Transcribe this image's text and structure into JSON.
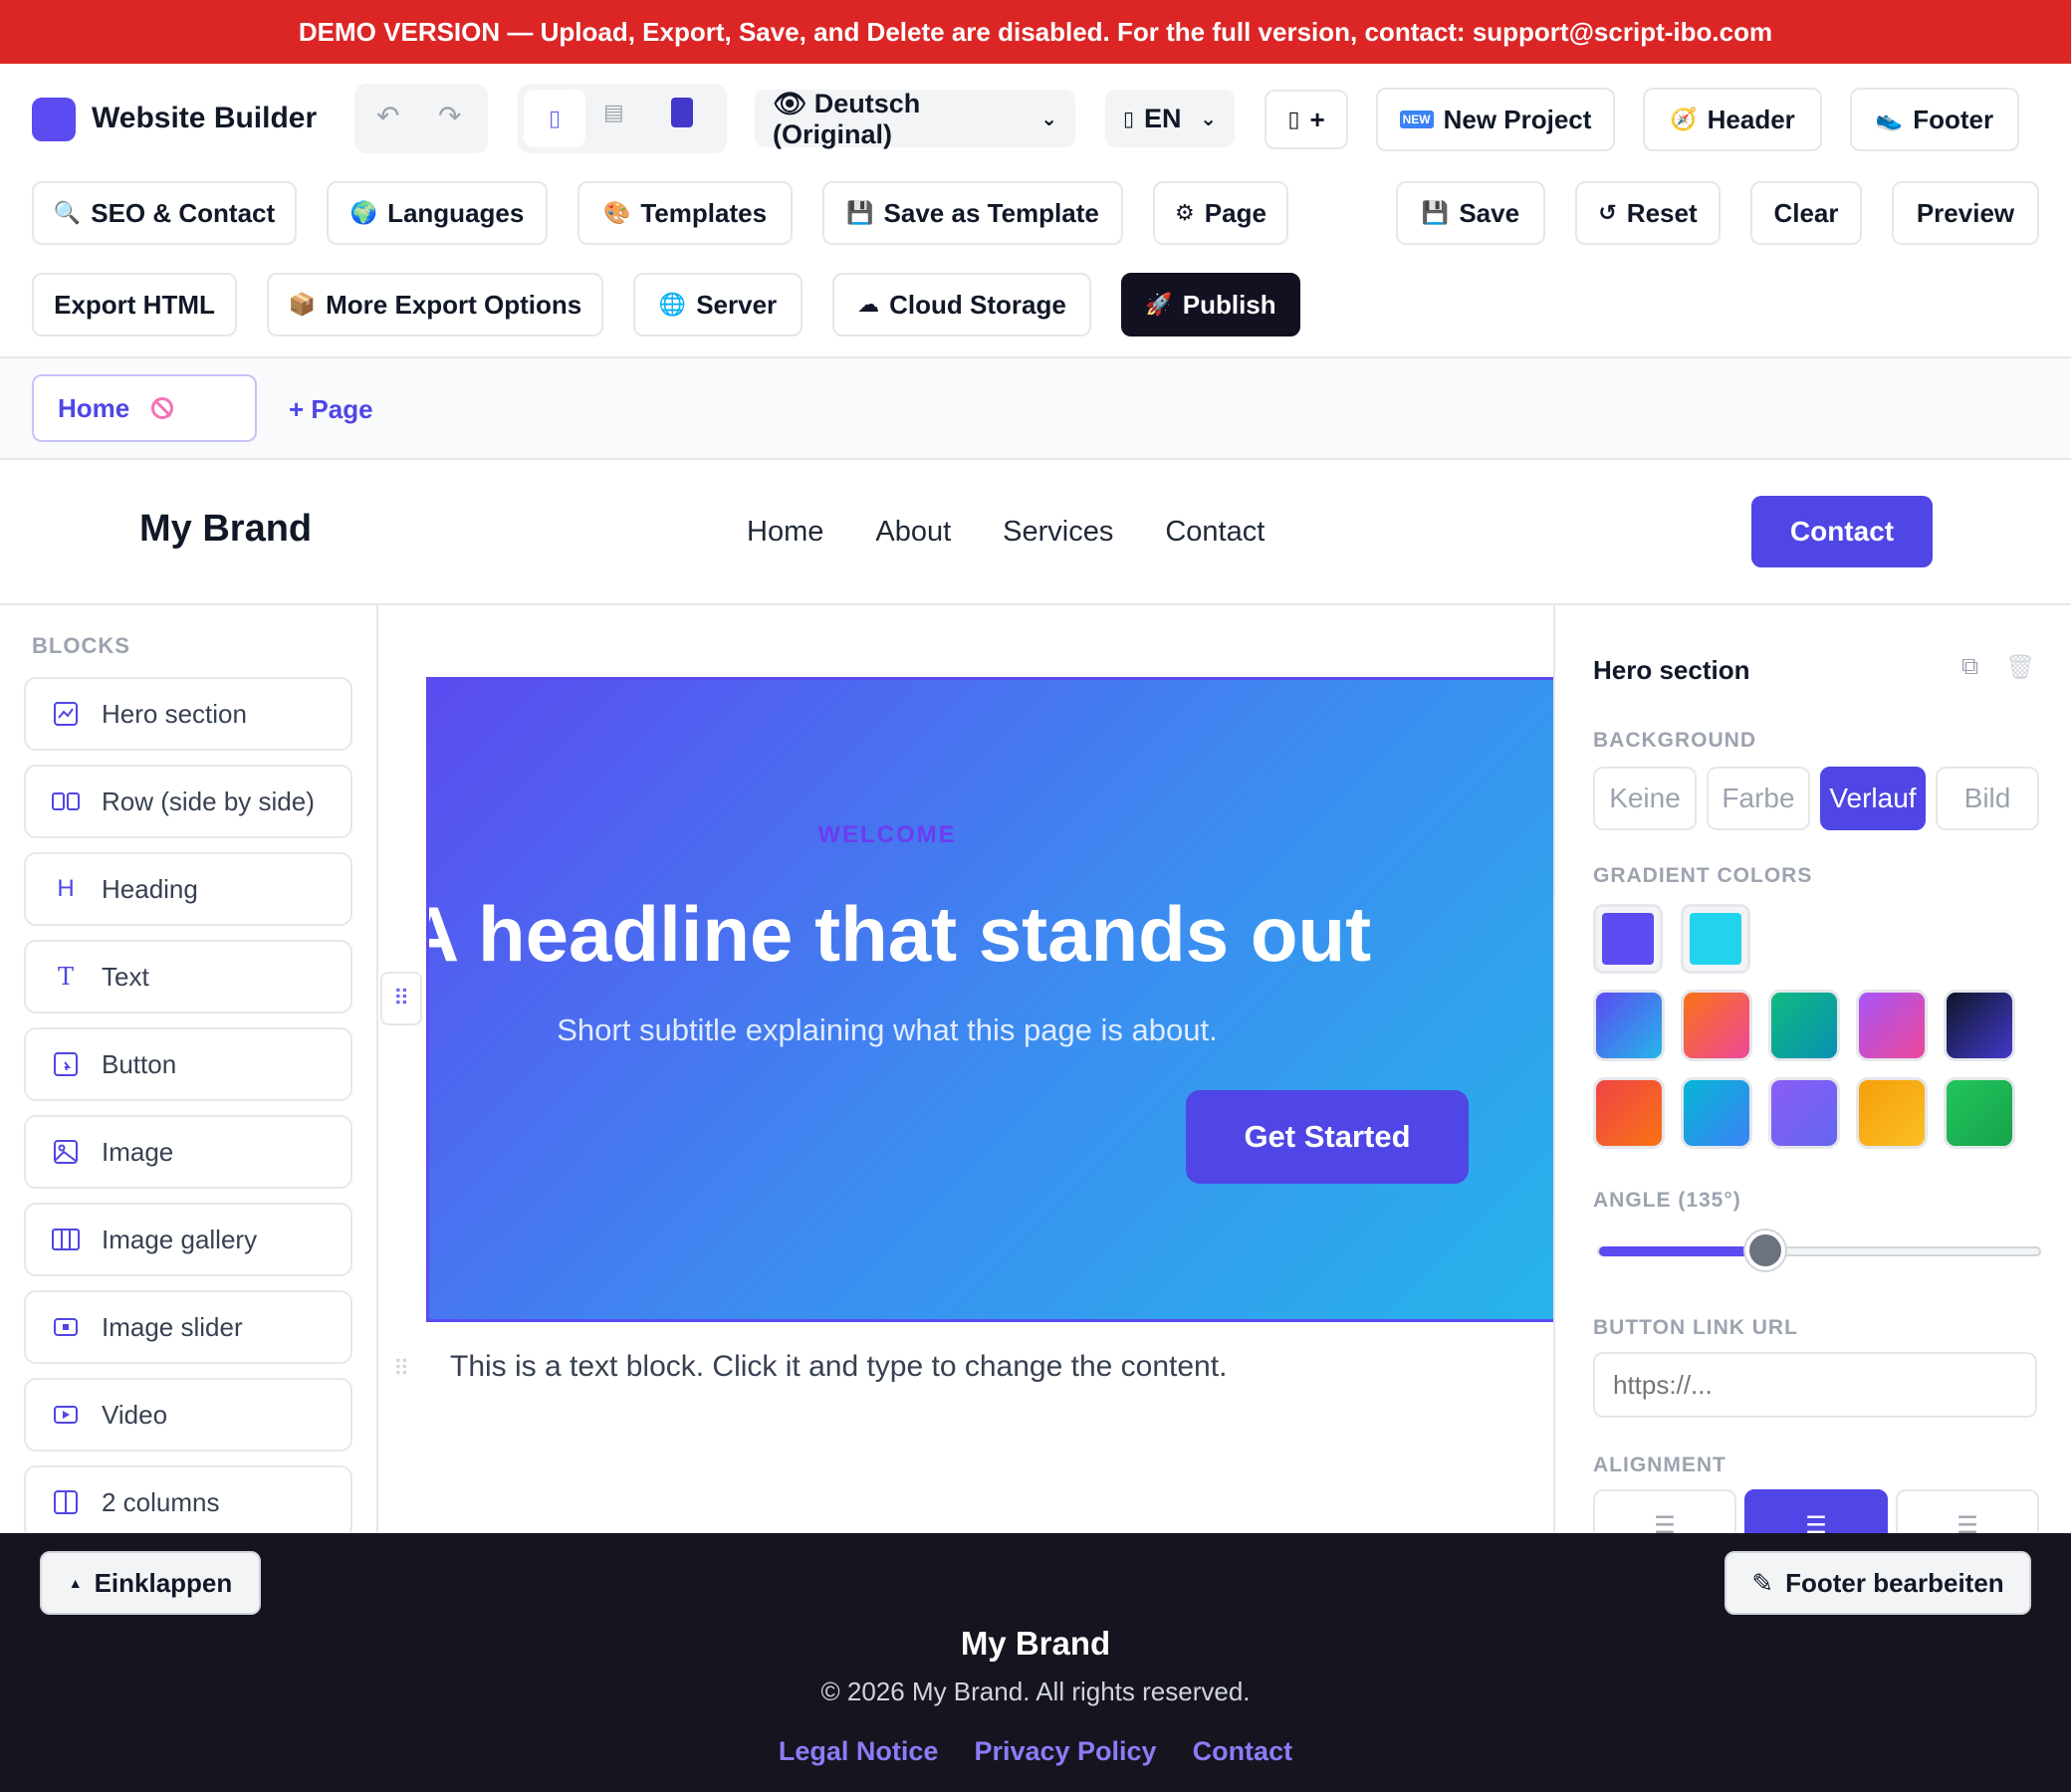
{
  "banner": {
    "text": "DEMO VERSION — Upload, Export, Save, and Delete are disabled. For the full version, contact: support@script-ibo.com"
  },
  "app": {
    "title": "Website Builder"
  },
  "toolbar": {
    "language_select": "👁 Deutsch (Original)",
    "lang_code": "EN",
    "add_lang": "+",
    "new_project": "New Project",
    "header": "Header",
    "footer": "Footer",
    "seo_contact": "SEO & Contact",
    "languages": "Languages",
    "templates": "Templates",
    "save_as_template": "Save as Template",
    "page": "Page",
    "save": "Save",
    "reset": "Reset",
    "clear": "Clear",
    "preview": "Preview",
    "export_html": "Export HTML",
    "more_export": "More Export Options",
    "server": "Server",
    "cloud_storage": "Cloud Storage",
    "publish": "Publish"
  },
  "pages": {
    "tabs": [
      {
        "label": "Home"
      }
    ],
    "add_label": "+ Page"
  },
  "site_header": {
    "brand": "My Brand",
    "nav": [
      "Home",
      "About",
      "Services",
      "Contact"
    ],
    "cta": "Contact"
  },
  "sidebar": {
    "title": "BLOCKS",
    "items": [
      {
        "label": "Hero section",
        "icon": "hero-icon"
      },
      {
        "label": "Row (side by side)",
        "icon": "row-icon"
      },
      {
        "label": "Heading",
        "icon": "heading-icon"
      },
      {
        "label": "Text",
        "icon": "text-icon"
      },
      {
        "label": "Button",
        "icon": "button-icon"
      },
      {
        "label": "Image",
        "icon": "image-icon"
      },
      {
        "label": "Image gallery",
        "icon": "gallery-icon"
      },
      {
        "label": "Image slider",
        "icon": "slider-icon"
      },
      {
        "label": "Video",
        "icon": "video-icon"
      },
      {
        "label": "2 columns",
        "icon": "columns-icon"
      }
    ]
  },
  "hero": {
    "eyebrow": "WELCOME",
    "headline": "A headline that stands out",
    "subtitle": "Short subtitle explaining what this page is about.",
    "button": "Get Started"
  },
  "text_block": {
    "content": "This is a text block. Click it and type to change the content."
  },
  "panel": {
    "title": "Hero section",
    "background_label": "BACKGROUND",
    "bg_options": [
      "Keine",
      "Farbe",
      "Verlauf",
      "Bild"
    ],
    "bg_selected": "Verlauf",
    "gradient_label": "GRADIENT COLORS",
    "gradient_from": "#5b4bf0",
    "gradient_to": "#22d3ee",
    "angle_label": "ANGLE (135°)",
    "angle_value": 135,
    "button_url_label": "BUTTON LINK URL",
    "button_url_placeholder": "https://...",
    "alignment_label": "ALIGNMENT",
    "alignment_selected": "center"
  },
  "footer": {
    "collapse": "Einklappen",
    "edit": "Footer bearbeiten",
    "brand": "My Brand",
    "copyright": "© 2026 My Brand. All rights reserved.",
    "links": [
      "Legal Notice",
      "Privacy Policy",
      "Contact"
    ]
  }
}
